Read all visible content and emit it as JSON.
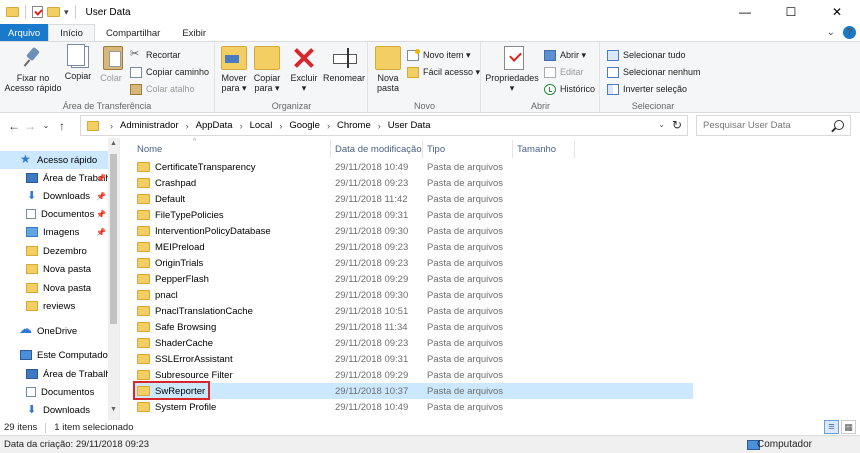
{
  "window": {
    "title": "User Data",
    "minimize": "—",
    "maximize": "☐",
    "close": "✕"
  },
  "ribbon_tabs": {
    "file": "Arquivo",
    "home": "Início",
    "share": "Compartilhar",
    "view": "Exibir"
  },
  "ribbon": {
    "clipboard": {
      "label": "Área de Transferência",
      "pin": "Fixar no Acesso rápido",
      "copy": "Copiar",
      "paste": "Colar",
      "cut": "Recortar",
      "copy_path": "Copiar caminho",
      "paste_shortcut": "Colar atalho"
    },
    "organize": {
      "label": "Organizar",
      "move_to": "Mover para ▾",
      "copy_to": "Copiar para ▾",
      "delete": "Excluir ▾",
      "rename": "Renomear"
    },
    "new": {
      "label": "Novo",
      "new_folder": "Nova pasta",
      "new_item": "Novo item ▾",
      "easy_access": "Fácil acesso ▾"
    },
    "open": {
      "label": "Abrir",
      "properties": "Propriedades ▾",
      "open": "Abrir ▾",
      "edit": "Editar",
      "history": "Histórico"
    },
    "select": {
      "label": "Selecionar",
      "select_all": "Selecionar tudo",
      "select_none": "Selecionar nenhum",
      "invert": "Inverter seleção"
    }
  },
  "address": {
    "crumbs": [
      "Administrador",
      "AppData",
      "Local",
      "Google",
      "Chrome",
      "User Data"
    ],
    "search_placeholder": "Pesquisar User Data"
  },
  "nav": {
    "items": [
      {
        "label": "Acesso rápido",
        "icon": "star-icon"
      },
      {
        "label": "Área de Trabalho",
        "icon": "desktop-icon"
      },
      {
        "label": "Downloads",
        "icon": "download-icon"
      },
      {
        "label": "Documentos",
        "icon": "document-icon"
      },
      {
        "label": "Imagens",
        "icon": "pictures-icon"
      },
      {
        "label": "Dezembro",
        "icon": "folder-icon"
      },
      {
        "label": "Nova pasta",
        "icon": "folder-icon"
      },
      {
        "label": "Nova pasta",
        "icon": "folder-icon"
      },
      {
        "label": "reviews",
        "icon": "folder-icon"
      },
      {
        "label": "OneDrive",
        "icon": "cloud-icon"
      },
      {
        "label": "Este Computador",
        "icon": "computer-icon"
      },
      {
        "label": "Área de Trabalho",
        "icon": "desktop-icon"
      },
      {
        "label": "Documentos",
        "icon": "document-icon"
      },
      {
        "label": "Downloads",
        "icon": "download-icon"
      }
    ]
  },
  "columns": {
    "name": "Nome",
    "date": "Data de modificação",
    "type": "Tipo",
    "size": "Tamanho"
  },
  "files": [
    {
      "name": "CertificateTransparency",
      "date": "29/11/2018 10:49",
      "type": "Pasta de arquivos"
    },
    {
      "name": "Crashpad",
      "date": "29/11/2018 09:23",
      "type": "Pasta de arquivos"
    },
    {
      "name": "Default",
      "date": "29/11/2018 11:42",
      "type": "Pasta de arquivos"
    },
    {
      "name": "FileTypePolicies",
      "date": "29/11/2018 09:31",
      "type": "Pasta de arquivos"
    },
    {
      "name": "InterventionPolicyDatabase",
      "date": "29/11/2018 09:30",
      "type": "Pasta de arquivos"
    },
    {
      "name": "MEIPreload",
      "date": "29/11/2018 09:23",
      "type": "Pasta de arquivos"
    },
    {
      "name": "OriginTrials",
      "date": "29/11/2018 09:23",
      "type": "Pasta de arquivos"
    },
    {
      "name": "PepperFlash",
      "date": "29/11/2018 09:29",
      "type": "Pasta de arquivos"
    },
    {
      "name": "pnacl",
      "date": "29/11/2018 09:30",
      "type": "Pasta de arquivos"
    },
    {
      "name": "PnaclTranslationCache",
      "date": "29/11/2018 10:51",
      "type": "Pasta de arquivos"
    },
    {
      "name": "Safe Browsing",
      "date": "29/11/2018 11:34",
      "type": "Pasta de arquivos"
    },
    {
      "name": "ShaderCache",
      "date": "29/11/2018 09:23",
      "type": "Pasta de arquivos"
    },
    {
      "name": "SSLErrorAssistant",
      "date": "29/11/2018 09:31",
      "type": "Pasta de arquivos"
    },
    {
      "name": "Subresource Filter",
      "date": "29/11/2018 09:29",
      "type": "Pasta de arquivos"
    },
    {
      "name": "SwReporter",
      "date": "29/11/2018 10:37",
      "type": "Pasta de arquivos"
    },
    {
      "name": "System Profile",
      "date": "29/11/2018 10:49",
      "type": "Pasta de arquivos"
    }
  ],
  "status": {
    "count": "29 itens",
    "selected": "1 item selecionado",
    "created": "Data da criação: 29/11/2018 09:23",
    "location": "Computador"
  },
  "colors": {
    "accent": "#1979ca",
    "selection": "#cce8ff",
    "highlight": "#d9262c",
    "folder": "#f3cf63"
  }
}
